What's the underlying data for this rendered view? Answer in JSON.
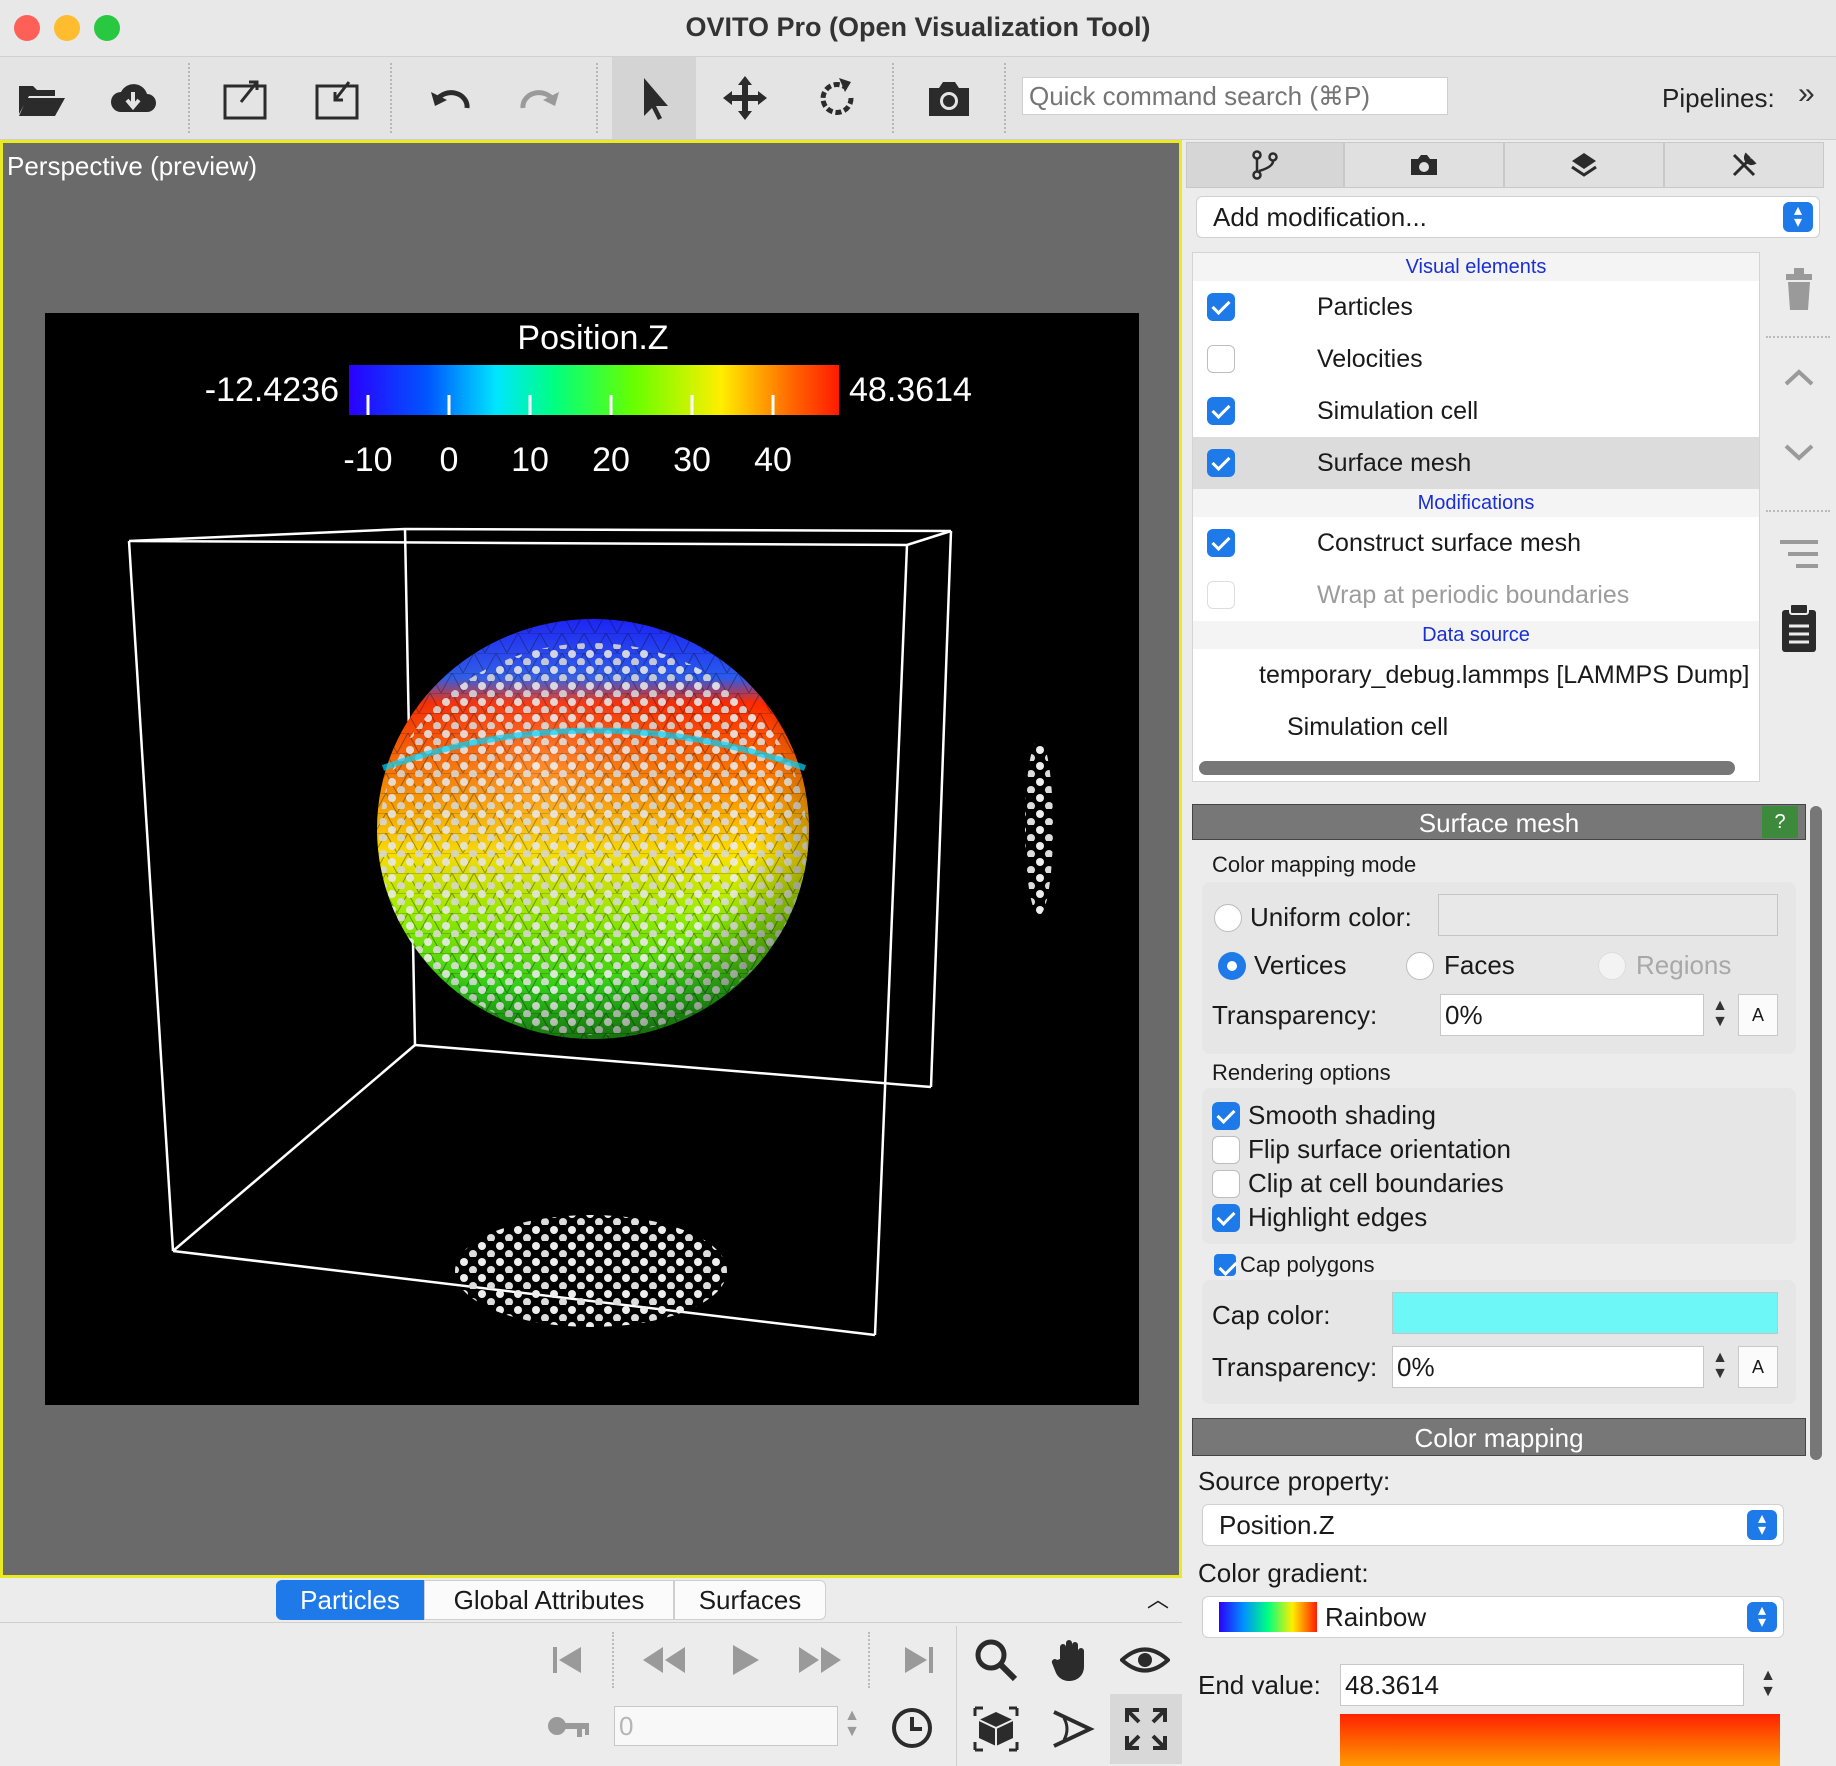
{
  "window": {
    "title": "OVITO Pro (Open Visualization Tool)"
  },
  "toolbar": {
    "search_placeholder": "Quick command search (⌘P)",
    "pipelines_label": "Pipelines:",
    "pipelines_arrow": "»"
  },
  "viewport": {
    "caption": "Perspective (preview)",
    "colorbar": {
      "title": "Position.Z",
      "min_label": "-12.4236",
      "max_label": "48.3614",
      "ticks": [
        "-10",
        "0",
        "10",
        "20",
        "30",
        "40"
      ]
    }
  },
  "bottom": {
    "tabs": [
      "Particles",
      "Global Attributes",
      "Surfaces"
    ],
    "active_tab": "Particles",
    "frame_value": "0"
  },
  "panel": {
    "add_modification": "Add modification...",
    "pipeline": {
      "visual_header": "Visual elements",
      "visual_items": [
        {
          "label": "Particles",
          "checked": true
        },
        {
          "label": "Velocities",
          "checked": false
        },
        {
          "label": "Simulation cell",
          "checked": true
        },
        {
          "label": "Surface mesh",
          "checked": true
        }
      ],
      "mod_header": "Modifications",
      "mod_items": [
        {
          "label": "Construct surface mesh",
          "checked": true
        },
        {
          "label": "Wrap at periodic boundaries",
          "checked": false
        }
      ],
      "source_header": "Data source",
      "source_items": [
        "temporary_debug.lammps [LAMMPS Dump]",
        "Simulation cell"
      ]
    },
    "surface_mesh": {
      "title": "Surface mesh",
      "help": "?",
      "color_mapping_mode_label": "Color mapping mode",
      "uniform_color_label": "Uniform color:",
      "vertices_label": "Vertices",
      "faces_label": "Faces",
      "regions_label": "Regions",
      "transparency_label": "Transparency:",
      "transparency_value": "0%",
      "a_label": "A",
      "rendering_options_label": "Rendering options",
      "smooth_shading": "Smooth shading",
      "flip_surface": "Flip surface orientation",
      "clip_cell": "Clip at cell boundaries",
      "highlight_edges": "Highlight edges",
      "cap_polygons": "Cap polygons",
      "cap_color_label": "Cap color:",
      "cap_color": "#6ef7f7",
      "cap_transparency_label": "Transparency:",
      "cap_transparency_value": "0%"
    },
    "color_mapping": {
      "title": "Color mapping",
      "source_property_label": "Source property:",
      "source_property": "Position.Z",
      "gradient_label": "Color gradient:",
      "gradient": "Rainbow",
      "end_value_label": "End value:",
      "end_value": "48.3614"
    }
  },
  "colors": {
    "accent": "#1e7ae8",
    "viewport_border": "#eaea22"
  }
}
